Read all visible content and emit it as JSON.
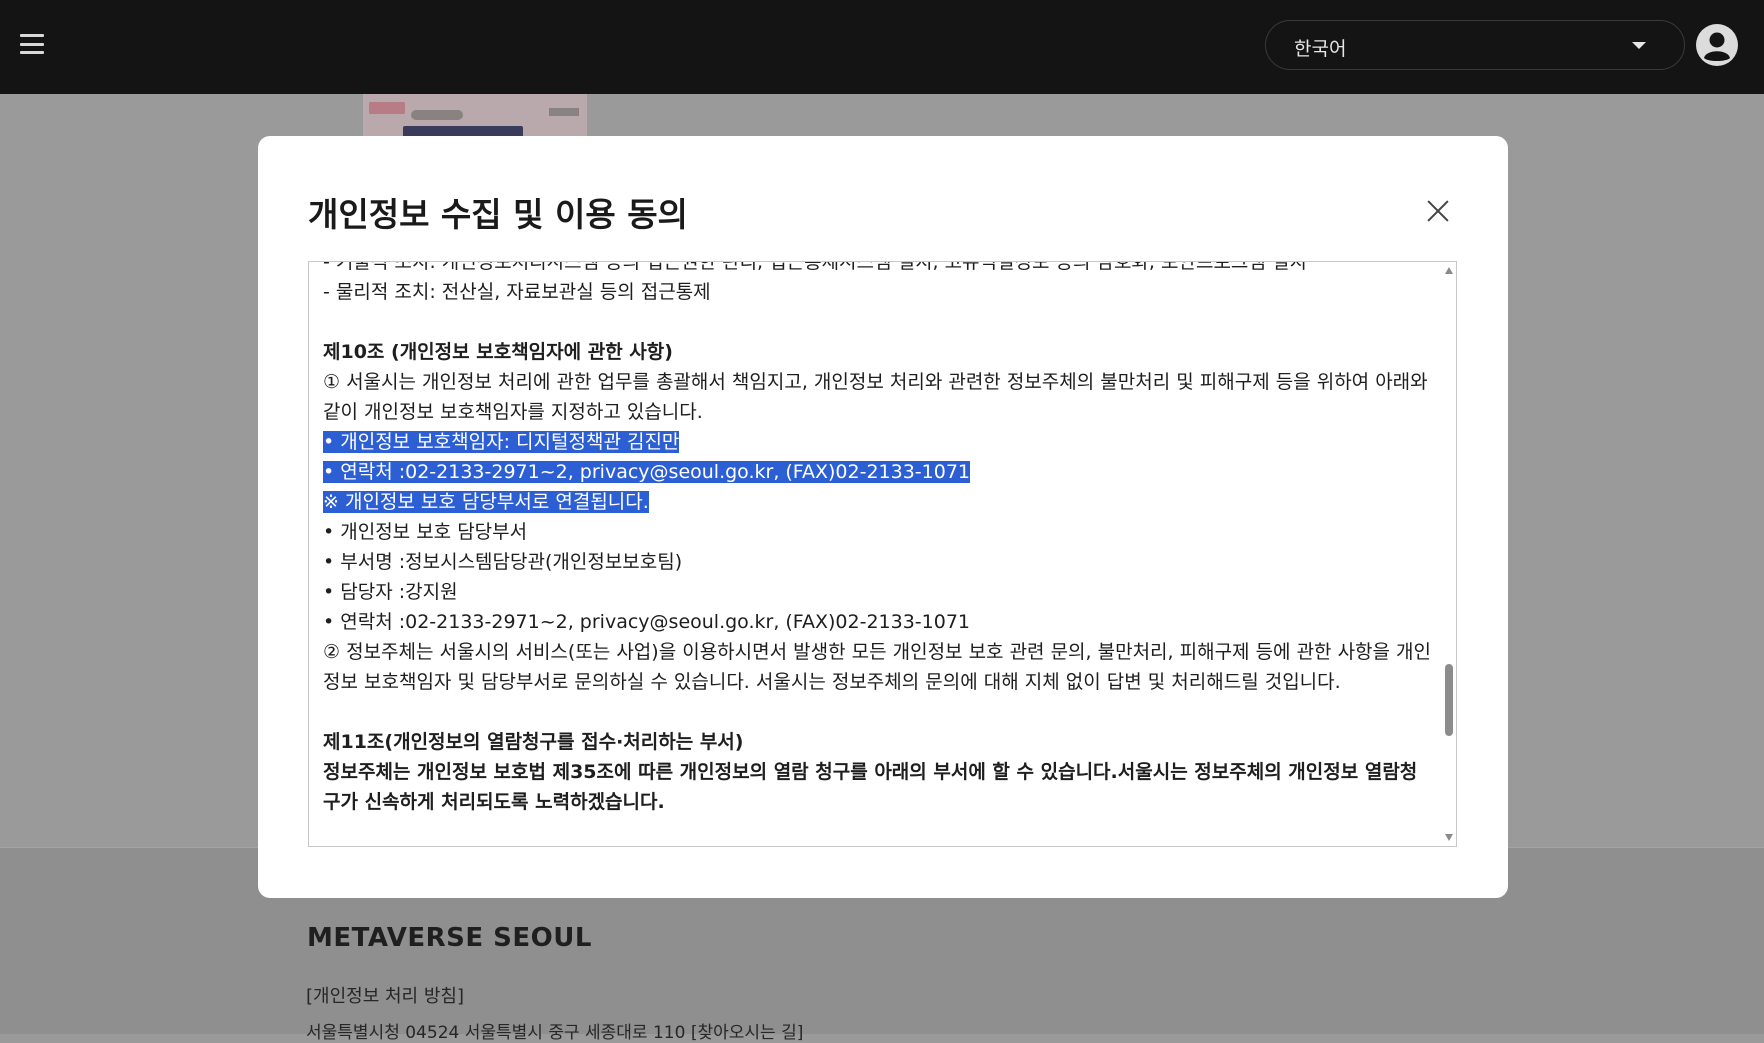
{
  "header": {
    "language": {
      "selected": "한국어"
    }
  },
  "background": {
    "footer": {
      "brand": "METAVERSE SEOUL",
      "policy_link": "[개인정보 처리 방침]",
      "address": "서울특별시청 04524 서울특별시 중구 세종대로 110 [찾아오시는 길]"
    }
  },
  "modal": {
    "title": "개인정보 수집 및 이용 동의",
    "lines": {
      "tech_measure": "- 기술적 조치: 개인정보처리시스템 등의 접근권한 관리, 접근통제시스템 설치, 고유식별정보 등의 암호화, 보안프로그램 설치",
      "physical_measure": "- 물리적 조치: 전산실, 자료보관실 등의 접근통제",
      "art10_title": "제10조 (개인정보 보호책임자에 관한 사항)",
      "art10_p1": "① 서울시는 개인정보 처리에 관한 업무를 총괄해서 책임지고, 개인정보 처리와 관련한 정보주체의 불만처리 및 피해구제 등을 위하여 아래와 같이 개인정보 보호책임자를 지정하고 있습니다.",
      "officer": "• 개인정보 보호책임자: 디지털정책관 김진만",
      "officer_contact": "• 연락처 :02-2133-2971~2, privacy@seoul.go.kr, (FAX)02-2133-1071",
      "officer_note": " ※ 개인정보 보호 담당부서로 연결됩니다.",
      "dept": "• 개인정보 보호 담당부서",
      "dept_name": "• 부서명 :정보시스템담당관(개인정보보호팀)",
      "dept_person": "• 담당자 :강지원",
      "dept_contact": "• 연락처 :02-2133-2971~2, privacy@seoul.go.kr, (FAX)02-2133-1071",
      "art10_p2": "② 정보주체는 서울시의 서비스(또는 사업)을 이용하시면서 발생한 모든 개인정보 보호 관련 문의, 불만처리, 피해구제 등에 관한 사항을 개인정보 보호책임자 및 담당부서로 문의하실 수 있습니다. 서울시는 정보주체의 문의에 대해 지체 없이 답변 및 처리해드릴 것입니다.",
      "art11_title": "제11조(개인정보의 열람청구를 접수·처리하는 부서)",
      "art11_p1": "정보주체는 개인정보 보호법 제35조에 따른 개인정보의 열람 청구를 아래의 부서에 할 수 있습니다.서울시는 정보주체의 개인정보 열람청구가 신속하게 처리되도록 노력하겠습니다."
    }
  },
  "colors": {
    "topbar": "#141414",
    "overlay": "#9a9a9a",
    "selection": "#2d5fd4"
  },
  "icons": {
    "menu": "hamburger-icon",
    "avatar": "user-circle-icon",
    "close": "close-icon",
    "dropdown": "chevron-down-icon"
  }
}
